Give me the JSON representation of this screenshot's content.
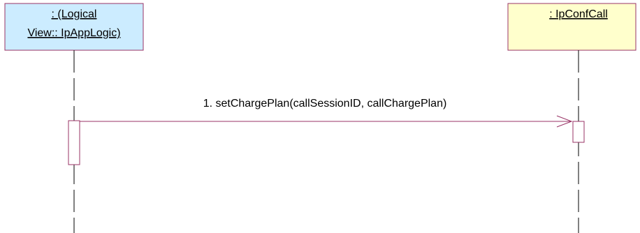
{
  "diagram": {
    "participants": [
      {
        "id": "logical-view-ipapplogic",
        "lines": [
          ": (Logical",
          "View:: IpAppLogic)"
        ],
        "fill": "#ccecff",
        "border": "#993366"
      },
      {
        "id": "ipconfcall",
        "lines": [
          ": IpConfCall"
        ],
        "fill": "#ffffcc",
        "border": "#993366"
      }
    ],
    "messages": [
      {
        "number": "1",
        "label": "1. setChargePlan(callSessionID, callChargePlan)",
        "from": "logical-view-ipapplogic",
        "to": "ipconfcall"
      }
    ],
    "colors": {
      "message_line": "#993366",
      "activation_border": "#993366",
      "lifeline": "#000000"
    }
  }
}
